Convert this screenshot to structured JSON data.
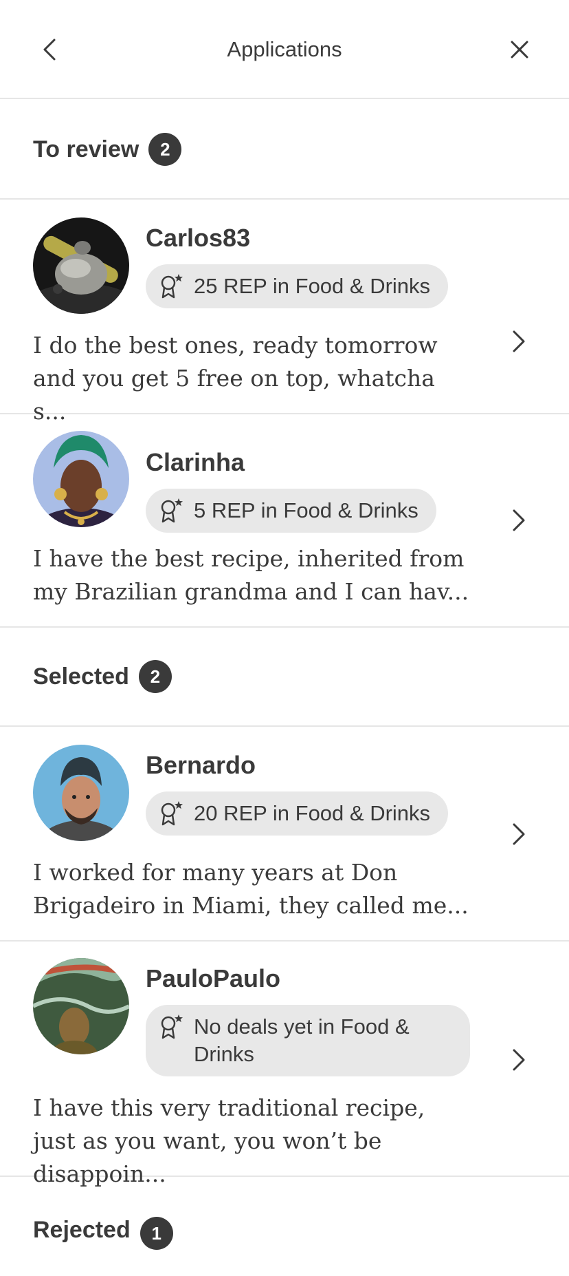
{
  "header": {
    "title": "Applications",
    "back_icon": "chevron-left-icon",
    "close_icon": "close-icon"
  },
  "sections": {
    "to_review": {
      "label": "To review",
      "count": "2"
    },
    "selected": {
      "label": "Selected",
      "count": "2"
    },
    "rejected": {
      "label": "Rejected",
      "count": "1"
    }
  },
  "applicants": [
    {
      "username": "Carlos83",
      "rep": "25 REP in Food & Drinks",
      "message": "I do the best ones, ready tomorrow and you get 5 free on top, whatcha s..."
    },
    {
      "username": "Clarinha",
      "rep": "5 REP in Food & Drinks",
      "message": "I have the best recipe, inherited from my Brazilian grandma and I can hav..."
    },
    {
      "username": "Bernardo",
      "rep": "20 REP in Food & Drinks",
      "message": "I worked for many years at Don Brigadeiro in Miami, they called me..."
    },
    {
      "username": "PauloPaulo",
      "rep": "No deals yet in Food & Drinks",
      "message": "I have this very traditional recipe, just as you want, you won’t be disappoin..."
    }
  ],
  "colors": {
    "text": "#3a3a3a",
    "divider": "#e6e6e6",
    "badge_bg": "#e8e8e8",
    "count_bg": "#3a3a3a"
  }
}
